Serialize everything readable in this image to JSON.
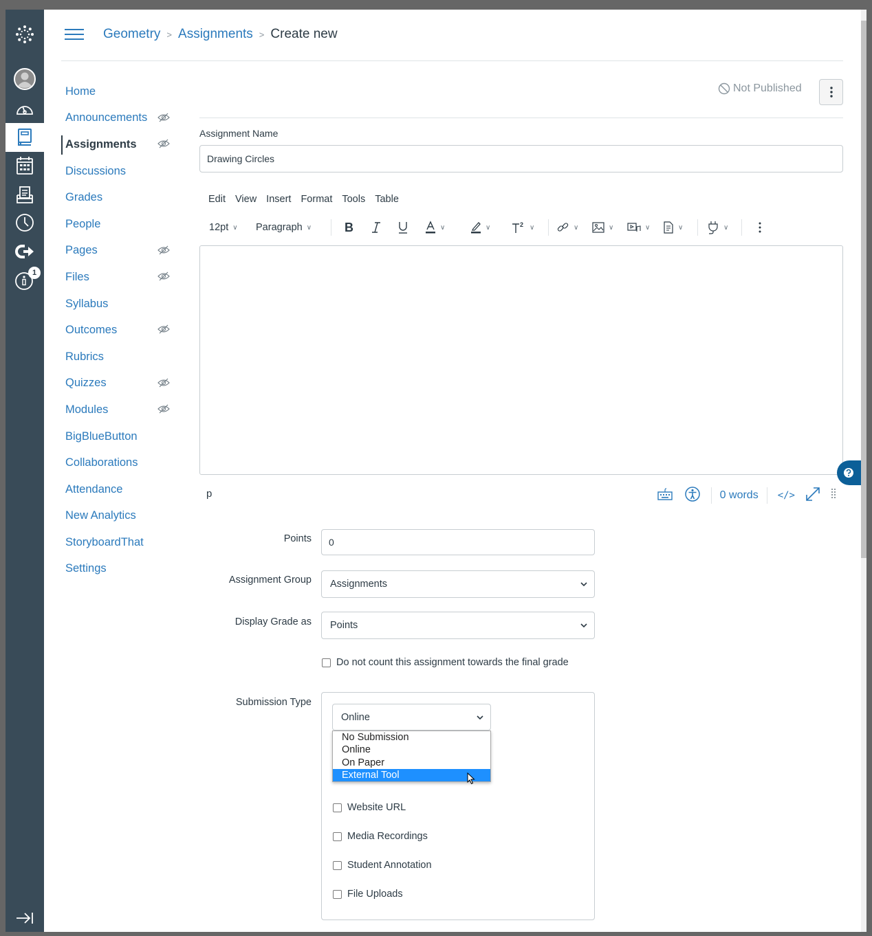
{
  "global_nav": {
    "items": [
      {
        "name": "logo",
        "icon": "canvas-logo-icon"
      },
      {
        "name": "account",
        "icon": "avatar-icon",
        "label": "Account"
      },
      {
        "name": "dashboard",
        "icon": "dashboard-icon",
        "label": "Dashboard"
      },
      {
        "name": "courses",
        "icon": "courses-icon",
        "label": "Courses",
        "active": true
      },
      {
        "name": "calendar",
        "icon": "calendar-icon",
        "label": "Calendar"
      },
      {
        "name": "inbox",
        "icon": "inbox-icon",
        "label": "Inbox"
      },
      {
        "name": "history",
        "icon": "clock-icon",
        "label": "History"
      },
      {
        "name": "commons",
        "icon": "commons-arrow-icon",
        "label": "Commons"
      },
      {
        "name": "help",
        "icon": "help-info-icon",
        "label": "Help",
        "badge": "1"
      }
    ],
    "collapse_icon": "collapse-arrow-icon"
  },
  "header": {
    "breadcrumb": [
      "Geometry",
      "Assignments",
      "Create new"
    ],
    "separator": ">"
  },
  "course_nav": {
    "items": [
      {
        "label": "Home",
        "hidden": false
      },
      {
        "label": "Announcements",
        "hidden": true
      },
      {
        "label": "Assignments",
        "hidden": true,
        "active": true
      },
      {
        "label": "Discussions",
        "hidden": false
      },
      {
        "label": "Grades",
        "hidden": false
      },
      {
        "label": "People",
        "hidden": false
      },
      {
        "label": "Pages",
        "hidden": true
      },
      {
        "label": "Files",
        "hidden": true
      },
      {
        "label": "Syllabus",
        "hidden": false
      },
      {
        "label": "Outcomes",
        "hidden": true
      },
      {
        "label": "Rubrics",
        "hidden": false
      },
      {
        "label": "Quizzes",
        "hidden": true
      },
      {
        "label": "Modules",
        "hidden": true
      },
      {
        "label": "BigBlueButton",
        "hidden": false
      },
      {
        "label": "Collaborations",
        "hidden": false
      },
      {
        "label": "Attendance",
        "hidden": false
      },
      {
        "label": "New Analytics",
        "hidden": false
      },
      {
        "label": "StoryboardThat",
        "hidden": false
      },
      {
        "label": "Settings",
        "hidden": false
      }
    ]
  },
  "main": {
    "publish_status": "Not Published",
    "assignment_name_label": "Assignment Name",
    "assignment_name_value": "Drawing Circles",
    "editor": {
      "menubar": [
        "Edit",
        "View",
        "Insert",
        "Format",
        "Tools",
        "Table"
      ],
      "font_size": "12pt",
      "block_format": "Paragraph",
      "status_element": "p",
      "word_count": "0 words",
      "html_toggle": "</>"
    },
    "points_label": "Points",
    "points_value": "0",
    "assignment_group_label": "Assignment Group",
    "assignment_group_value": "Assignments",
    "display_grade_label": "Display Grade as",
    "display_grade_value": "Points",
    "omit_from_final_label": "Do not count this assignment towards the final grade",
    "submission_type_label": "Submission Type",
    "submission_type_value": "Online",
    "submission_type_options": [
      "No Submission",
      "Online",
      "On Paper",
      "External Tool"
    ],
    "submission_type_highlighted": "External Tool",
    "online_entry_options": [
      "Website URL",
      "Media Recordings",
      "Student Annotation",
      "File Uploads"
    ]
  },
  "colors": {
    "nav_bg": "#394b58",
    "link": "#2b7abc",
    "text": "#2d3b45",
    "highlight": "#1e90ff",
    "help_tab": "#0c5f98"
  }
}
